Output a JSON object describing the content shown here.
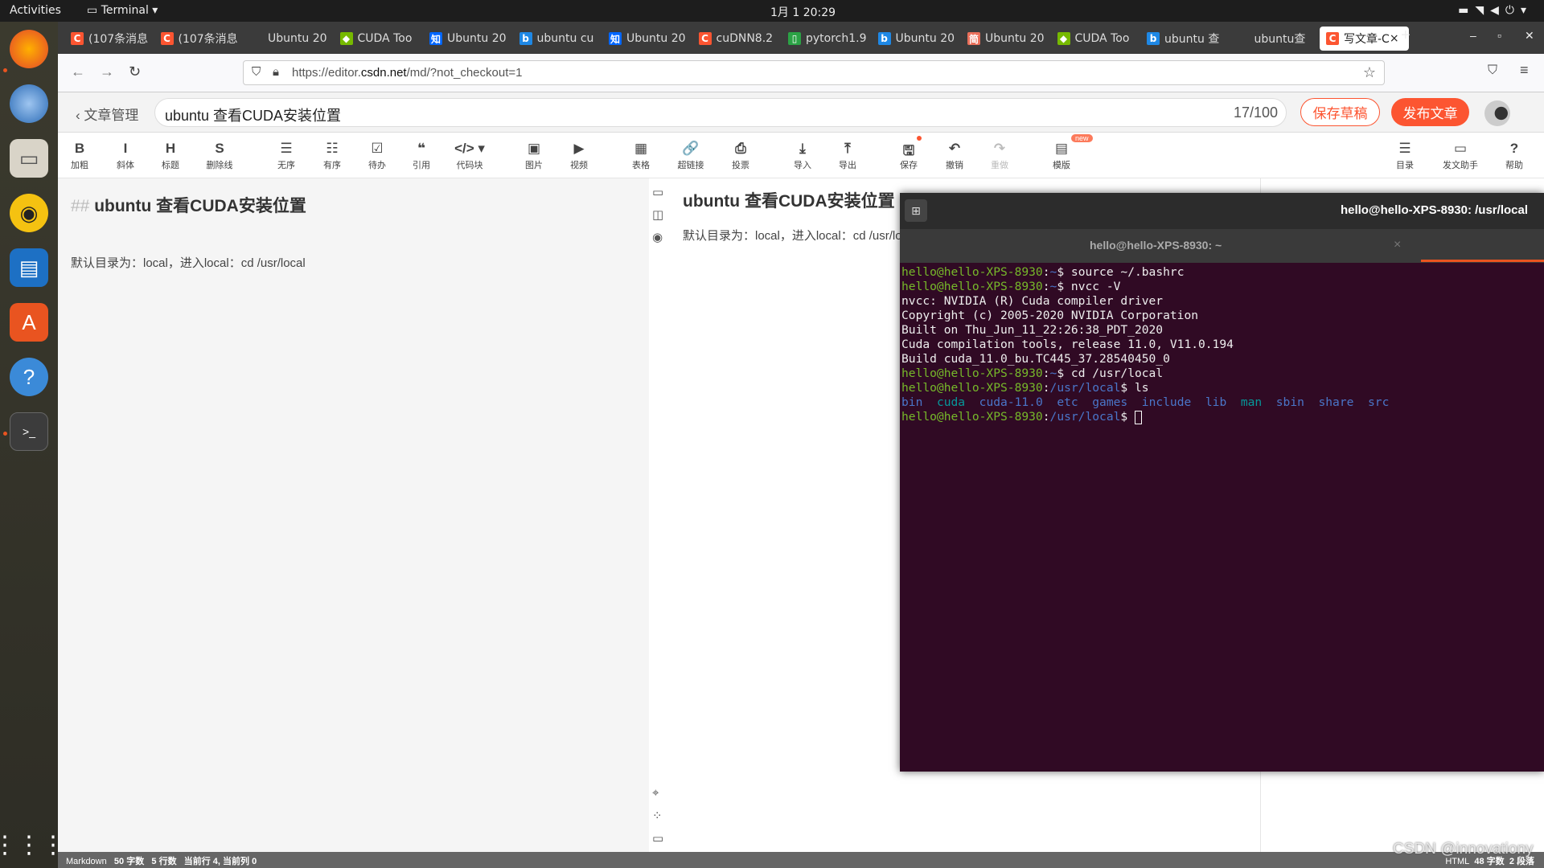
{
  "topbar": {
    "activities": "Activities",
    "app": "Terminal",
    "clock": "1月 1  20:29"
  },
  "dock": [
    "firefox",
    "thunderbird",
    "files",
    "rhythmbox",
    "libreoffice-writer",
    "software-center",
    "help",
    "terminal",
    "app-grid"
  ],
  "tabs": [
    {
      "title": "(107条消息",
      "icon": "C",
      "color": "#fc5531"
    },
    {
      "title": "(107条消息",
      "icon": "C",
      "color": "#fc5531"
    },
    {
      "title": "Ubuntu 20",
      "icon": "",
      "color": ""
    },
    {
      "title": "CUDA Too",
      "icon": "◆",
      "color": "#76b900"
    },
    {
      "title": "Ubuntu 20",
      "icon": "知",
      "color": "#0066ff"
    },
    {
      "title": "ubuntu cu",
      "icon": "b",
      "color": "#1e88e5"
    },
    {
      "title": "Ubuntu 20",
      "icon": "知",
      "color": "#0066ff"
    },
    {
      "title": "cuDNN8.2",
      "icon": "C",
      "color": "#fc5531"
    },
    {
      "title": "pytorch1.9",
      "icon": "▯",
      "color": "#2ba245"
    },
    {
      "title": "Ubuntu 20",
      "icon": "b",
      "color": "#1e88e5"
    },
    {
      "title": "Ubuntu 20",
      "icon": "简",
      "color": "#ea6f5a"
    },
    {
      "title": "CUDA Too",
      "icon": "◆",
      "color": "#76b900"
    },
    {
      "title": "ubuntu 查",
      "icon": "b",
      "color": "#1e88e5"
    },
    {
      "title": "ubuntu查",
      "icon": "",
      "color": ""
    },
    {
      "title": "写文章-C",
      "icon": "C",
      "color": "#fc5531",
      "active": true
    }
  ],
  "browser": {
    "url_prefix": "https://editor.",
    "url_domain": "csdn.net",
    "url_path": "/md/?not_checkout=1"
  },
  "editor": {
    "back_label": "文章管理",
    "title": "ubuntu 查看CUDA安装位置",
    "title_count": "17/100",
    "save_draft": "保存草稿",
    "publish": "发布文章",
    "accent": "#fc5531",
    "toolbar": [
      {
        "label": "加粗",
        "icon": "B"
      },
      {
        "label": "斜体",
        "icon": "I"
      },
      {
        "label": "标题",
        "icon": "H"
      },
      {
        "label": "删除线",
        "icon": "S"
      },
      {
        "label": "无序",
        "icon": "☰"
      },
      {
        "label": "有序",
        "icon": "☷"
      },
      {
        "label": "待办",
        "icon": "☑"
      },
      {
        "label": "引用",
        "icon": "❝"
      },
      {
        "label": "代码块",
        "icon": "</> ▾"
      },
      {
        "label": "图片",
        "icon": "▣"
      },
      {
        "label": "视频",
        "icon": "▶"
      },
      {
        "label": "表格",
        "icon": "▦"
      },
      {
        "label": "超链接",
        "icon": "🔗"
      },
      {
        "label": "投票",
        "icon": "⎙"
      },
      {
        "label": "导入",
        "icon": "⤓"
      },
      {
        "label": "导出",
        "icon": "⤒"
      },
      {
        "label": "保存",
        "icon": "🖫"
      },
      {
        "label": "撤销",
        "icon": "↶"
      },
      {
        "label": "重做",
        "icon": "↷"
      },
      {
        "label": "模版",
        "icon": "▤"
      },
      {
        "label": "目录",
        "icon": "☰"
      },
      {
        "label": "发文助手",
        "icon": "▭"
      },
      {
        "label": "帮助",
        "icon": "?"
      }
    ],
    "new_badge": "new",
    "markdown": {
      "heading_marker": "##",
      "heading": "ubuntu 查看CUDA安装位置",
      "body": "默认目录为：local，进入local：cd /usr/local"
    },
    "preview": {
      "heading": "ubuntu 查看CUDA安装位置",
      "body": "默认目录为：local，进入local：cd /usr/local"
    },
    "status_left": {
      "mode": "Markdown",
      "chars": "50 字数",
      "lines": "5 行数",
      "cursor": "当前行 4, 当前列 0"
    },
    "status_right": {
      "mode": "HTML",
      "chars": "48 字数",
      "paras": "2 段落"
    },
    "watermark": "CSDN @innovationy"
  },
  "terminal": {
    "window_title": "hello@hello-XPS-8930: /usr/local",
    "tab_title": "hello@hello-XPS-8930: ~",
    "prompt_user": "hello@hello-XPS-8930",
    "lines": [
      {
        "type": "cmd",
        "path": "~",
        "cmd": "source ~/.bashrc"
      },
      {
        "type": "cmd",
        "path": "~",
        "cmd": "nvcc -V"
      },
      {
        "type": "out",
        "text": "nvcc: NVIDIA (R) Cuda compiler driver"
      },
      {
        "type": "out",
        "text": "Copyright (c) 2005-2020 NVIDIA Corporation"
      },
      {
        "type": "out",
        "text": "Built on Thu_Jun_11_22:26:38_PDT_2020"
      },
      {
        "type": "out",
        "text": "Cuda compilation tools, release 11.0, V11.0.194"
      },
      {
        "type": "out",
        "text": "Build cuda_11.0_bu.TC445_37.28540450_0"
      },
      {
        "type": "cmd",
        "path": "~",
        "cmd": "cd /usr/local"
      },
      {
        "type": "cmd",
        "path": "/usr/local",
        "cmd": "ls"
      },
      {
        "type": "ls",
        "items": [
          {
            "n": "bin",
            "c": "b"
          },
          {
            "n": "cuda",
            "c": "c"
          },
          {
            "n": "cuda-11.0",
            "c": "b"
          },
          {
            "n": "etc",
            "c": "b"
          },
          {
            "n": "games",
            "c": "b"
          },
          {
            "n": "include",
            "c": "b"
          },
          {
            "n": "lib",
            "c": "b"
          },
          {
            "n": "man",
            "c": "c"
          },
          {
            "n": "sbin",
            "c": "b"
          },
          {
            "n": "share",
            "c": "b"
          },
          {
            "n": "src",
            "c": "b"
          }
        ]
      },
      {
        "type": "cmd",
        "path": "/usr/local",
        "cmd": "",
        "cursor": true
      }
    ]
  }
}
